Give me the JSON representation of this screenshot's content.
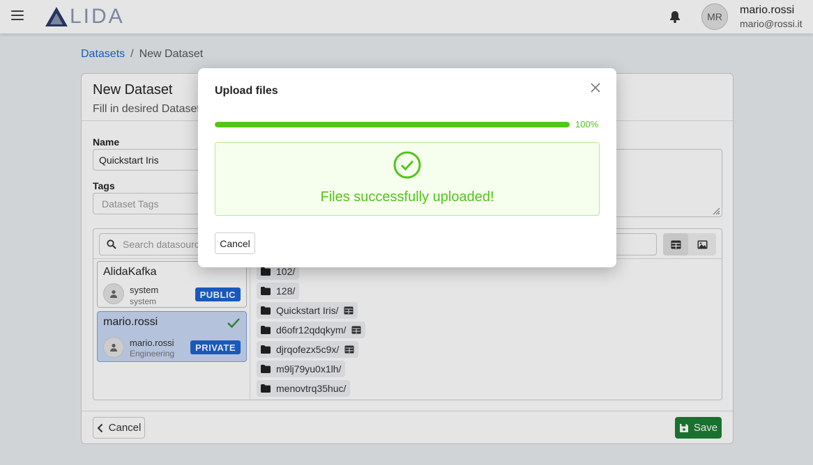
{
  "header": {
    "logo_text": "LIDA",
    "avatar_initials": "MR",
    "user_name": "mario.rossi",
    "user_email": "mario@rossi.it"
  },
  "breadcrumb": {
    "parent": "Datasets",
    "separator": "/",
    "current": "New Dataset"
  },
  "card": {
    "title": "New Dataset",
    "subtitle": "Fill in desired Dataset",
    "name_label": "Name",
    "name_value": "Quickstart Iris",
    "tags_label": "Tags",
    "tags_placeholder": "Dataset Tags"
  },
  "datasources": {
    "search_placeholder": "Search datasource",
    "items": [
      {
        "name": "AlidaKafka",
        "owner": "system",
        "team": "system",
        "badge": "PUBLIC",
        "selected": false
      },
      {
        "name": "mario.rossi",
        "owner": "mario.rossi",
        "team": "Engineering",
        "badge": "PRIVATE",
        "selected": true
      }
    ]
  },
  "folders": [
    {
      "label": "102/",
      "table_icon": false
    },
    {
      "label": "128/",
      "table_icon": false
    },
    {
      "label": "Quickstart Iris/",
      "table_icon": true
    },
    {
      "label": "d6ofr12qdqkym/",
      "table_icon": true
    },
    {
      "label": "djrqofezx5c9x/",
      "table_icon": true
    },
    {
      "label": "m9lj79yu0x1lh/",
      "table_icon": false
    },
    {
      "label": "menovtrq35huc/",
      "table_icon": false
    }
  ],
  "footer": {
    "cancel_label": "Cancel",
    "save_label": "Save"
  },
  "modal": {
    "title": "Upload files",
    "progress_percent": 100,
    "progress_text": "100%",
    "success_text": "Files successfully uploaded!",
    "cancel_label": "Cancel"
  },
  "colors": {
    "primary": "#1c64d1",
    "success": "#52c41a",
    "save": "#1e7e34"
  }
}
